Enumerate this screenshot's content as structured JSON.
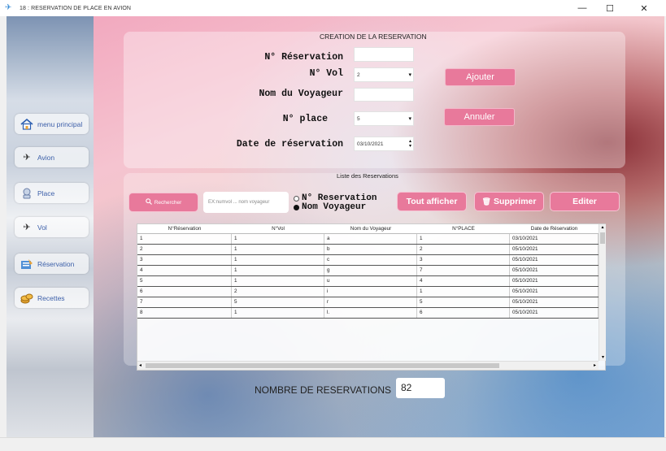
{
  "window": {
    "title": "18 : RESERVATION DE PLACE EN AVION",
    "min": "—",
    "max": "☐",
    "close": "✕"
  },
  "nav": [
    {
      "label": "menu principal",
      "icon": "home-icon"
    },
    {
      "label": "Avion",
      "icon": "airplane-icon"
    },
    {
      "label": "Place",
      "icon": "seat-icon"
    },
    {
      "label": "Vol",
      "icon": "flight-icon"
    },
    {
      "label": "Réservation",
      "icon": "reservation-icon"
    },
    {
      "label": "Recettes",
      "icon": "coins-icon"
    }
  ],
  "form": {
    "title": "CREATION DE LA RESERVATION",
    "num_reservation_label": "N° Réservation",
    "num_reservation_value": "",
    "num_vol_label": "N° Vol",
    "num_vol_value": "2",
    "nom_voyageur_label": "Nom du Voyageur",
    "nom_voyageur_value": "",
    "num_place_label": "N° place",
    "num_place_value": "5",
    "date_label": "Date de réservation",
    "date_value": "03/10/2021",
    "ajouter": "Ajouter",
    "annuler": "Annuler"
  },
  "list": {
    "title": "Liste des Reservations",
    "search_btn": "Rechercher",
    "search_placeholder": "EX:numvol ... nom voyageur",
    "radio1": "N° Reservation",
    "radio2": "Nom Voyageur",
    "tout_afficher": "Tout afficher",
    "supprimer": "Supprimer",
    "editer": "Editer"
  },
  "table": {
    "columns": [
      "N°Réservation",
      "N°Vol",
      "Nom du Voyageur",
      "N°PLACE",
      "Date de Réservation"
    ],
    "rows": [
      [
        "1",
        "1",
        "a",
        "1",
        "03/10/2021"
      ],
      [
        "2",
        "1",
        "b",
        "2",
        "05/10/2021"
      ],
      [
        "3",
        "1",
        "c",
        "3",
        "05/10/2021"
      ],
      [
        "4",
        "1",
        "g",
        "7",
        "05/10/2021"
      ],
      [
        "5",
        "1",
        "u",
        "4",
        "05/10/2021"
      ],
      [
        "6",
        "2",
        "i",
        "1",
        "05/10/2021"
      ],
      [
        "7",
        "5",
        "r",
        "5",
        "05/10/2021"
      ],
      [
        "8",
        "1",
        "l.",
        "6",
        "05/10/2021"
      ]
    ]
  },
  "footer": {
    "label": "NOMBRE DE RESERVATIONS",
    "count": "82"
  }
}
